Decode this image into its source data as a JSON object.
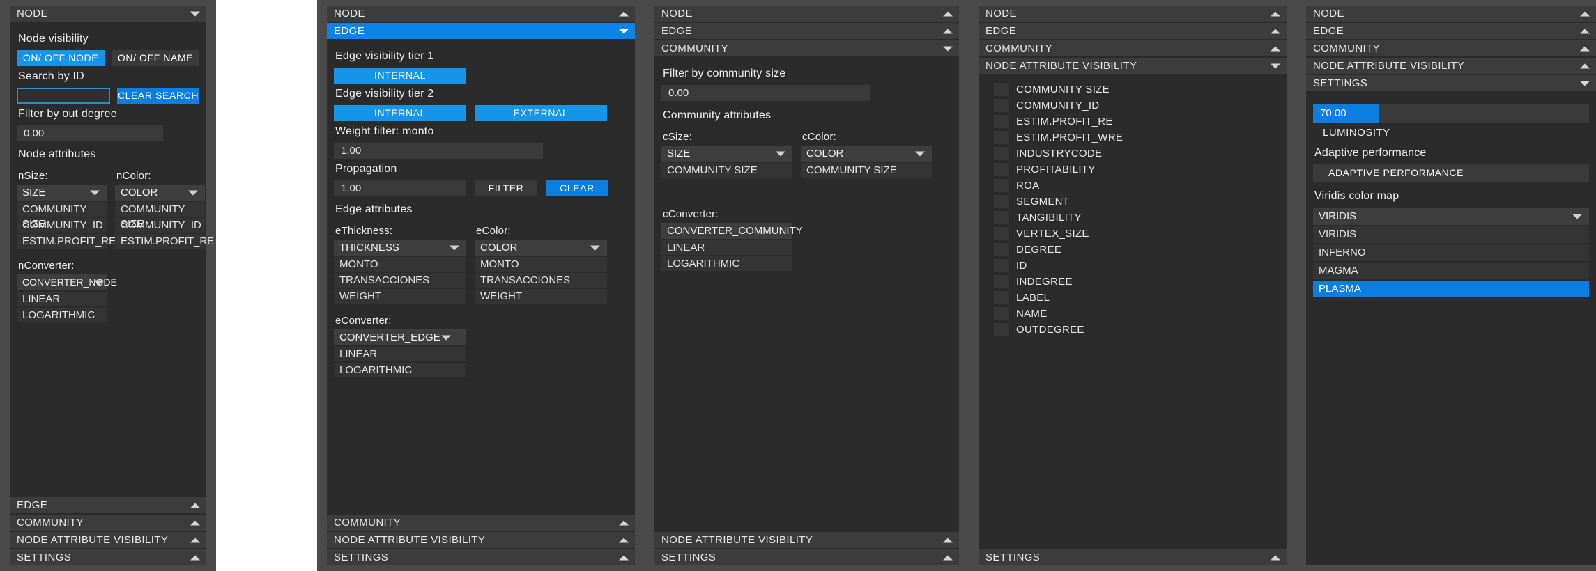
{
  "colors": {
    "accent": "#0a7fe0",
    "accent_bright": "#1595e8",
    "panel_bg": "#2b2b2b",
    "outer_bg": "#4a4a4a",
    "control_bg": "#3a3a3a",
    "text": "#f0f0f0"
  },
  "sections": {
    "node": "NODE",
    "edge": "EDGE",
    "community": "COMMUNITY",
    "node_attribute_visibility": "NODE ATTRIBUTE VISIBILITY",
    "settings": "SETTINGS"
  },
  "panel1": {
    "title": "NODE",
    "node_visibility_label": "Node visibility",
    "on_off_node": "ON/ OFF NODE",
    "on_off_name": "ON/ OFF NAME",
    "search_label": "Search by ID",
    "search_value": "",
    "search_placeholder": "",
    "clear_search": "CLEAR SEARCH",
    "filter_label": "Filter by out degree",
    "filter_value": "0.00",
    "attributes_label": "Node attributes",
    "nsize_label": "nSize:",
    "nsize_value": "SIZE",
    "nsize_options": [
      "COMMUNITY SIZE",
      "COMMUNITY_ID",
      "ESTIM.PROFIT_RE"
    ],
    "ncolor_label": "nColor:",
    "ncolor_value": "COLOR",
    "ncolor_options": [
      "COMMUNITY SIZE",
      "COMMUNITY_ID",
      "ESTIM.PROFIT_RE"
    ],
    "nconverter_label": "nConverter:",
    "nconverter_value": "CONVERTER_NODE",
    "nconverter_options": [
      "LINEAR",
      "LOGARITHMIC"
    ],
    "bottom_tabs": [
      "EDGE",
      "COMMUNITY",
      "NODE ATTRIBUTE VISIBILITY",
      "SETTINGS"
    ]
  },
  "panel2": {
    "top_tabs": [
      "NODE",
      "EDGE"
    ],
    "active_tab": "EDGE",
    "tier1_label": "Edge visibility tier 1",
    "tier1_internal": "INTERNAL",
    "tier2_label": "Edge visibility tier 2",
    "tier2_internal": "INTERNAL",
    "tier2_external": "EXTERNAL",
    "weight_label": "Weight filter: monto",
    "weight_value": "1.00",
    "propagation_label": "Propagation",
    "propagation_value": "1.00",
    "filter_button": "FILTER",
    "clear_button": "CLEAR",
    "edge_attributes_label": "Edge attributes",
    "ethickness_label": "eThickness:",
    "ethickness_value": "THICKNESS",
    "ethickness_options": [
      "MONTO",
      "TRANSACCIONES",
      "WEIGHT"
    ],
    "ecolor_label": "eColor:",
    "ecolor_value": "COLOR",
    "ecolor_options": [
      "MONTO",
      "TRANSACCIONES",
      "WEIGHT"
    ],
    "econverter_label": "eConverter:",
    "econverter_value": "CONVERTER_EDGE",
    "econverter_options": [
      "LINEAR",
      "LOGARITHMIC"
    ],
    "bottom_tabs": [
      "COMMUNITY",
      "NODE ATTRIBUTE VISIBILITY",
      "SETTINGS"
    ]
  },
  "panel3": {
    "top_tabs": [
      "NODE",
      "EDGE",
      "COMMUNITY"
    ],
    "active_tab": "COMMUNITY",
    "filter_label": "Filter by community size",
    "filter_value": "0.00",
    "attributes_label": "Community attributes",
    "csize_label": "cSize:",
    "csize_value": "SIZE",
    "csize_options": [
      "COMMUNITY SIZE"
    ],
    "ccolor_label": "cColor:",
    "ccolor_value": "COLOR",
    "ccolor_options": [
      "COMMUNITY SIZE"
    ],
    "cconverter_label": "cConverter:",
    "cconverter_value": "CONVERTER_COMMUNITY",
    "cconverter_options": [
      "LINEAR",
      "LOGARITHMIC"
    ],
    "bottom_tabs": [
      "NODE ATTRIBUTE VISIBILITY",
      "SETTINGS"
    ]
  },
  "panel4": {
    "top_tabs": [
      "NODE",
      "EDGE",
      "COMMUNITY",
      "NODE ATTRIBUTE VISIBILITY"
    ],
    "active_tab": "NODE ATTRIBUTE VISIBILITY",
    "attributes": [
      "COMMUNITY SIZE",
      "COMMUNITY_ID",
      "ESTIM.PROFIT_RE",
      "ESTIM.PROFIT_WRE",
      "INDUSTRYCODE",
      "PROFITABILITY",
      "ROA",
      "SEGMENT",
      "TANGIBILITY",
      "VERTEX_SIZE",
      "DEGREE",
      "ID",
      "INDEGREE",
      "LABEL",
      "NAME",
      "OUTDEGREE"
    ],
    "bottom_tabs": [
      "SETTINGS"
    ]
  },
  "panel5": {
    "top_tabs": [
      "NODE",
      "EDGE",
      "COMMUNITY",
      "NODE ATTRIBUTE VISIBILITY",
      "SETTINGS"
    ],
    "active_tab": "SETTINGS",
    "luminosity_value": "70.00",
    "luminosity_label": "LUMINOSITY",
    "adaptive_label": "Adaptive performance",
    "adaptive_button": "ADAPTIVE PERFORMANCE",
    "colormap_label": "Viridis color map",
    "colormap_value": "VIRIDIS",
    "colormap_options": [
      "VIRIDIS",
      "INFERNO",
      "MAGMA",
      "PLASMA"
    ],
    "colormap_selected": "PLASMA"
  }
}
